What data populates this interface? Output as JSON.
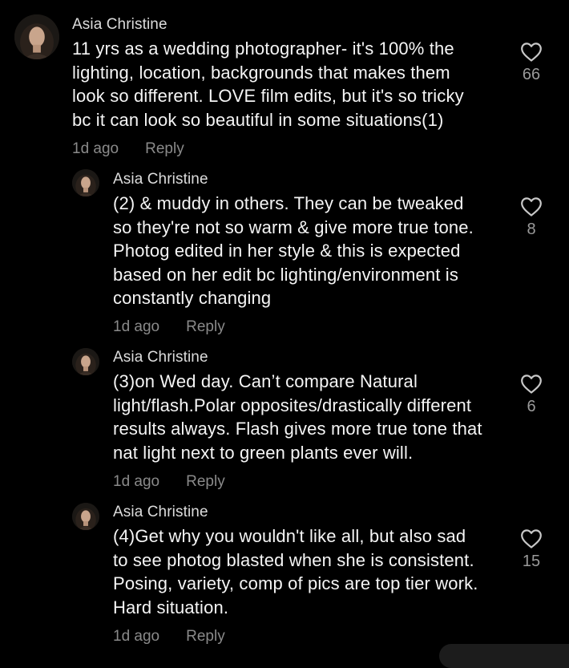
{
  "colors": {
    "background": "#000000",
    "text": "#f5f5f5",
    "muted": "#8a8a8a",
    "heart_outline": "#c8c8c8"
  },
  "comments": [
    {
      "author": "Asia Christine",
      "lines": [
        "11 yrs as a wedding photographer- it's 100% the",
        "lighting, location, backgrounds that makes them",
        "look so different. LOVE film edits, but it's so tricky",
        "bc it can look so beautiful in some situations(1)"
      ],
      "time": "1d ago",
      "reply_label": "Reply",
      "likes": "66",
      "like_icon": "heart-outline-icon"
    },
    {
      "author": "Asia Christine",
      "lines": [
        "(2) & muddy in others. They can be tweaked",
        "so they're not so warm & give more true tone.",
        "Photog edited in her style & this is expected",
        "based on her edit bc lighting/environment is",
        "constantly changing"
      ],
      "time": "1d ago",
      "reply_label": "Reply",
      "likes": "8",
      "like_icon": "heart-outline-icon"
    },
    {
      "author": "Asia Christine",
      "lines": [
        "(3)on Wed day. Can’t compare Natural",
        "light/flash.Polar opposites/drastically different",
        "results always. Flash gives more true tone that",
        "nat light next to green plants ever will."
      ],
      "time": "1d ago",
      "reply_label": "Reply",
      "likes": "6",
      "like_icon": "heart-outline-icon"
    },
    {
      "author": "Asia Christine",
      "lines": [
        "(4)Get why you wouldn't like all, but also sad",
        "to see photog blasted when she is consistent.",
        "Posing, variety, comp of pics are top tier work.",
        "Hard situation."
      ],
      "time": "1d ago",
      "reply_label": "Reply",
      "likes": "15",
      "like_icon": "heart-outline-icon"
    }
  ]
}
